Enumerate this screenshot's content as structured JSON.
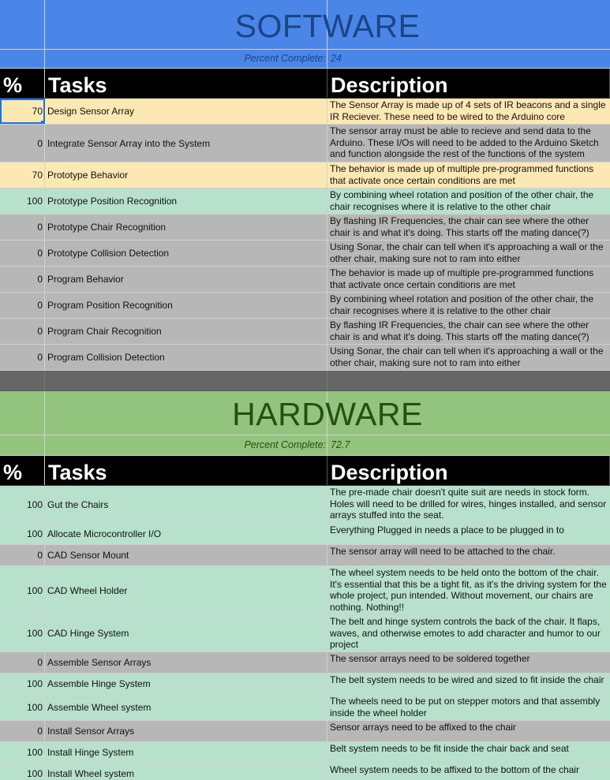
{
  "software": {
    "title": "SOFTWARE",
    "percent_label": "Percent Complete:",
    "percent_value": "24",
    "headers": {
      "pct": "%",
      "tasks": "Tasks",
      "description": "Description"
    },
    "rows": [
      {
        "pct": "70",
        "task": "Design Sensor Array",
        "description": "The Sensor Array is made up of 4 sets of IR beacons and a single IR Reciever. These need to be wired to the Arduino core",
        "color": "yellow"
      },
      {
        "pct": "0",
        "task": "Integrate Sensor Array into the System",
        "description": "The sensor array must be able to recieve and send data to the Arduino. These I/Os will need to be added to the Arduino Sketch and function alongside the rest of the functions of the system",
        "color": "gray"
      },
      {
        "pct": "70",
        "task": "Prototype Behavior",
        "description": "The behavior is made up of multiple pre-programmed functions that activate once certain conditions are met",
        "color": "yellow"
      },
      {
        "pct": "100",
        "task": "Prototype Position Recognition",
        "description": "By combining wheel rotation and position of the other chair, the chair recognises where it is relative to the other chair",
        "color": "green"
      },
      {
        "pct": "0",
        "task": "Prototype Chair Recognition",
        "description": "By flashing IR Frequencies, the chair can see where the other chair is and what it's doing. This starts off the mating dance(?)",
        "color": "gray"
      },
      {
        "pct": "0",
        "task": "Prototype Collision Detection",
        "description": "Using Sonar, the chair can tell when it's approaching a wall or the other chair, making sure not to ram into either",
        "color": "gray"
      },
      {
        "pct": "0",
        "task": "Program Behavior",
        "description": "The behavior is made up of multiple pre-programmed functions that activate once certain conditions are met",
        "color": "gray"
      },
      {
        "pct": "0",
        "task": "Program Position Recognition",
        "description": "By combining wheel rotation and position of the other chair, the chair recognises where it is relative to the other chair",
        "color": "gray"
      },
      {
        "pct": "0",
        "task": "Program Chair Recognition",
        "description": "By flashing IR Frequencies, the chair can see where the other chair is and what it's doing. This starts off the mating dance(?)",
        "color": "gray"
      },
      {
        "pct": "0",
        "task": "Program Collision Detection",
        "description": "Using Sonar, the chair can tell when it's approaching a wall or the other chair, making sure not to ram into either",
        "color": "gray"
      }
    ]
  },
  "hardware": {
    "title": "HARDWARE",
    "percent_label": "Percent Complete:",
    "percent_value": "72.7",
    "headers": {
      "pct": "%",
      "tasks": "Tasks",
      "description": "Description"
    },
    "rows": [
      {
        "pct": "100",
        "task": "Gut the Chairs",
        "description": "The pre-made chair doesn't quite suit are needs in stock form. Holes will need to be drilled for wires, hinges installed, and sensor arrays stuffed into the seat.",
        "color": "green"
      },
      {
        "pct": "100",
        "task": "Allocate Microcontroller I/O",
        "description": "Everything Plugged in needs a place to be plugged in to",
        "color": "green"
      },
      {
        "pct": "0",
        "task": "CAD Sensor Mount",
        "description": "The sensor array will need to be attached to the chair.",
        "color": "gray"
      },
      {
        "pct": "100",
        "task": "CAD Wheel Holder",
        "description": "The wheel system needs to be held onto the bottom of the chair. It's essential that this be a tight fit, as it's the driving system for the whole project, pun intended. Without movement, our chairs are nothing. Nothing!!",
        "color": "green"
      },
      {
        "pct": "100",
        "task": "CAD Hinge System",
        "description": "The belt and hinge system controls the back of the chair. It flaps, waves, and otherwise emotes to add character and humor to our project",
        "color": "green"
      },
      {
        "pct": "0",
        "task": "Assemble Sensor Arrays",
        "description": "The sensor arrays need to be soldered together",
        "color": "gray"
      },
      {
        "pct": "100",
        "task": "Assemble Hinge System",
        "description": "The belt system needs to be wired and sized to fit inside the chair",
        "color": "green"
      },
      {
        "pct": "100",
        "task": "Assemble Wheel system",
        "description": "The wheels need to be put on stepper motors and that assembly inside the wheel holder",
        "color": "green"
      },
      {
        "pct": "0",
        "task": "Install Sensor Arrays",
        "description": "Sensor arrays need to be affixed to the chair",
        "color": "gray"
      },
      {
        "pct": "100",
        "task": "Install Hinge System",
        "description": "Belt system needs to be fit inside the chair back and seat",
        "color": "green"
      },
      {
        "pct": "100",
        "task": "Install Wheel system",
        "description": "Wheel system needs to be affixed to the bottom of the chair",
        "color": "green"
      }
    ]
  },
  "colors": {
    "software_banner": "#4a86e8",
    "software_title": "#1c4587",
    "hardware_banner": "#93c47d",
    "hardware_title": "#274e13",
    "separator": "#666666",
    "yellow": "#fce8b2",
    "gray": "#b7b7b7",
    "green": "#b7e1cd"
  }
}
